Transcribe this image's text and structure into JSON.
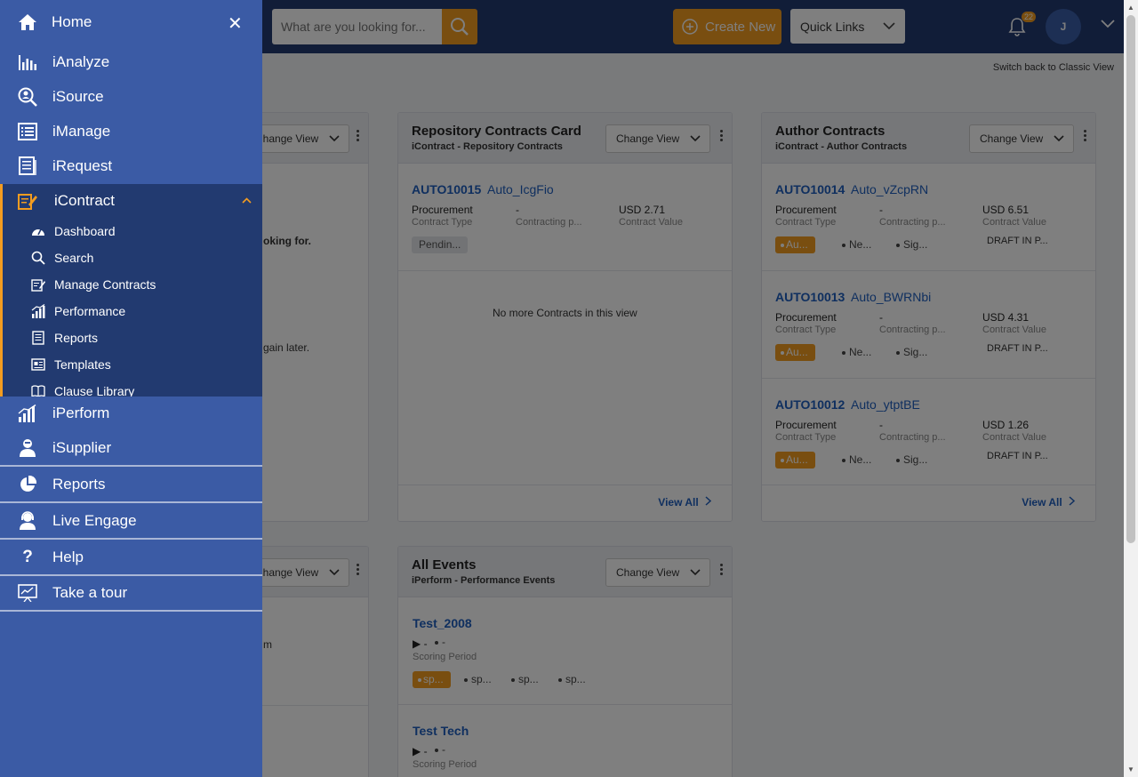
{
  "header": {
    "search_placeholder": "What are you looking for...",
    "create_new_label": "Create New",
    "quick_links_label": "Quick Links",
    "notification_count": "22",
    "avatar_initial": "J",
    "classic_view_link": "Switch back to Classic View"
  },
  "sidebar": {
    "home_label": "Home",
    "items": [
      {
        "label": "iAnalyze",
        "icon": "bar-chart-icon"
      },
      {
        "label": "iSource",
        "icon": "search-user-icon"
      },
      {
        "label": "iManage",
        "icon": "list-icon"
      },
      {
        "label": "iRequest",
        "icon": "document-icon"
      }
    ],
    "icontract": {
      "label": "iContract",
      "submenu": [
        {
          "label": "Dashboard",
          "icon": "dashboard-icon"
        },
        {
          "label": "Search",
          "icon": "search-icon"
        },
        {
          "label": "Manage Contracts",
          "icon": "edit-document-icon"
        },
        {
          "label": "Performance",
          "icon": "performance-icon"
        },
        {
          "label": "Reports",
          "icon": "report-icon"
        },
        {
          "label": "Templates",
          "icon": "template-icon"
        },
        {
          "label": "Clause Library",
          "icon": "book-icon"
        }
      ]
    },
    "lower_items": [
      {
        "label": "iPerform",
        "icon": "performance-icon"
      },
      {
        "label": "iSupplier",
        "icon": "supplier-icon"
      }
    ],
    "bottom_items": [
      {
        "label": "Reports",
        "icon": "pie-chart-icon"
      },
      {
        "label": "Live Engage",
        "icon": "headset-icon"
      },
      {
        "label": "Help",
        "icon": "help-icon"
      },
      {
        "label": "Take a tour",
        "icon": "tour-icon"
      }
    ]
  },
  "cards": {
    "left_top": {
      "change_view": "Change View",
      "text1": "oking for.",
      "text2": "gain later."
    },
    "left_bottom": {
      "change_view": "Change View",
      "text1": "m"
    },
    "repository": {
      "title": "Repository Contracts Card",
      "subtitle": "iContract - Repository Contracts",
      "change_view": "Change View",
      "items": [
        {
          "id": "AUTO10015",
          "name": "Auto_IcgFio",
          "type_value": "Procurement",
          "type_label": "Contract Type",
          "party_value": "-",
          "party_label": "Contracting p...",
          "value": "USD 2.71",
          "value_label": "Contract Value",
          "status": "Pendin..."
        }
      ],
      "empty_message": "No more Contracts in this view",
      "view_all": "View All"
    },
    "author": {
      "title": "Author Contracts",
      "subtitle": "iContract - Author Contracts",
      "change_view": "Change View",
      "items": [
        {
          "id": "AUTO10014",
          "name": "Auto_vZcpRN",
          "type_value": "Procurement",
          "type_label": "Contract Type",
          "party_value": "-",
          "party_label": "Contracting p...",
          "value": "USD 6.51",
          "value_label": "Contract Value",
          "pill": "Au...",
          "tag1": "Ne...",
          "tag2": "Sig...",
          "status": "DRAFT IN P..."
        },
        {
          "id": "AUTO10013",
          "name": "Auto_BWRNbi",
          "type_value": "Procurement",
          "type_label": "Contract Type",
          "party_value": "-",
          "party_label": "Contracting p...",
          "value": "USD 4.31",
          "value_label": "Contract Value",
          "pill": "Au...",
          "tag1": "Ne...",
          "tag2": "Sig...",
          "status": "DRAFT IN P..."
        },
        {
          "id": "AUTO10012",
          "name": "Auto_ytptBE",
          "type_value": "Procurement",
          "type_label": "Contract Type",
          "party_value": "-",
          "party_label": "Contracting p...",
          "value": "USD 1.26",
          "value_label": "Contract Value",
          "pill": "Au...",
          "tag1": "Ne...",
          "tag2": "Sig...",
          "status": "DRAFT IN P..."
        }
      ],
      "view_all": "View All"
    },
    "events": {
      "title": "All Events",
      "subtitle": "iPerform - Performance Events",
      "change_view": "Change View",
      "items": [
        {
          "name": "Test_2008",
          "meta1": "-",
          "meta2": "-",
          "period_label": "Scoring Period",
          "pill": "sp...",
          "tag1": "sp...",
          "tag2": "sp...",
          "tag3": "sp..."
        },
        {
          "name": "Test Tech",
          "meta1": "-",
          "meta2": "-",
          "period_label": "Scoring Period"
        }
      ]
    }
  },
  "colors": {
    "sidebar": "#3b5ba5",
    "sidebar_active": "#223a70",
    "accent": "#f39c20",
    "link": "#1f5fbf"
  }
}
